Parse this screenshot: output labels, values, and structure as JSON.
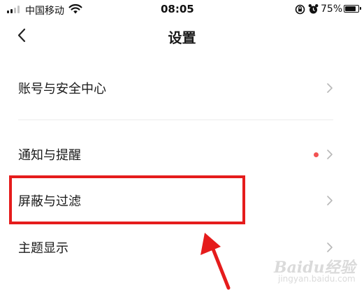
{
  "status_bar": {
    "carrier": "中国移动",
    "time": "08:05",
    "battery_percent": "75%",
    "battery_level": 0.75,
    "icons": [
      "signal-icon",
      "wifi-icon",
      "rotation-lock-icon",
      "alarm-icon",
      "battery-icon"
    ]
  },
  "nav": {
    "title": "设置",
    "back_icon": "chevron-left-icon"
  },
  "settings": {
    "items": [
      {
        "label": "账号与安全中心",
        "icon": "chevron-right-icon",
        "badge": false
      },
      {
        "label": "通知与提醒",
        "icon": "chevron-right-icon",
        "badge": true
      },
      {
        "label": "屏蔽与过滤",
        "icon": "chevron-right-icon",
        "badge": false
      },
      {
        "label": "主题显示",
        "icon": "chevron-right-icon",
        "badge": false
      }
    ]
  },
  "watermark": {
    "brand": "Baidu经验",
    "url": "jingyan.baidu.com"
  },
  "colors": {
    "annotation": "#e51c1c",
    "badge": "#f25252",
    "chevron": "#b8b8b8",
    "divider": "#ececec"
  }
}
